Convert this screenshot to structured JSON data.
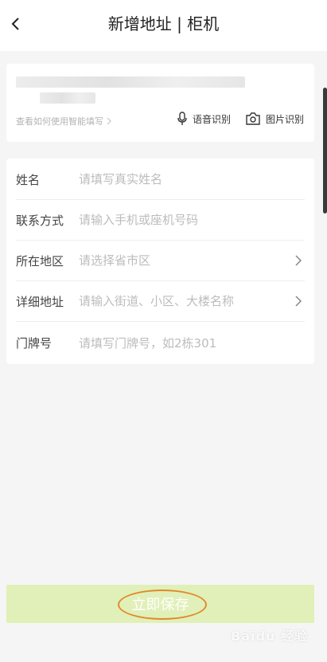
{
  "header": {
    "title": "新增地址 | 柜机"
  },
  "smart_fill": {
    "hint": "查看如何使用智能填写",
    "voice_label": "语音识别",
    "image_label": "图片识别"
  },
  "form": {
    "rows": [
      {
        "label": "姓名",
        "placeholder": "请填写真实姓名",
        "has_arrow": false
      },
      {
        "label": "联系方式",
        "placeholder": "请输入手机或座机号码",
        "has_arrow": false
      },
      {
        "label": "所在地区",
        "placeholder": "请选择省市区",
        "has_arrow": true
      },
      {
        "label": "详细地址",
        "placeholder": "请输入街道、小区、大楼名称",
        "has_arrow": true
      },
      {
        "label": "门牌号",
        "placeholder": "请填写门牌号，如2栋301",
        "has_arrow": false
      }
    ]
  },
  "footer": {
    "save_label": "立即保存",
    "watermark": "Baidu 经验"
  },
  "colors": {
    "save_button": "#e1f0b8",
    "annotation_ring": "#e08a2c"
  }
}
